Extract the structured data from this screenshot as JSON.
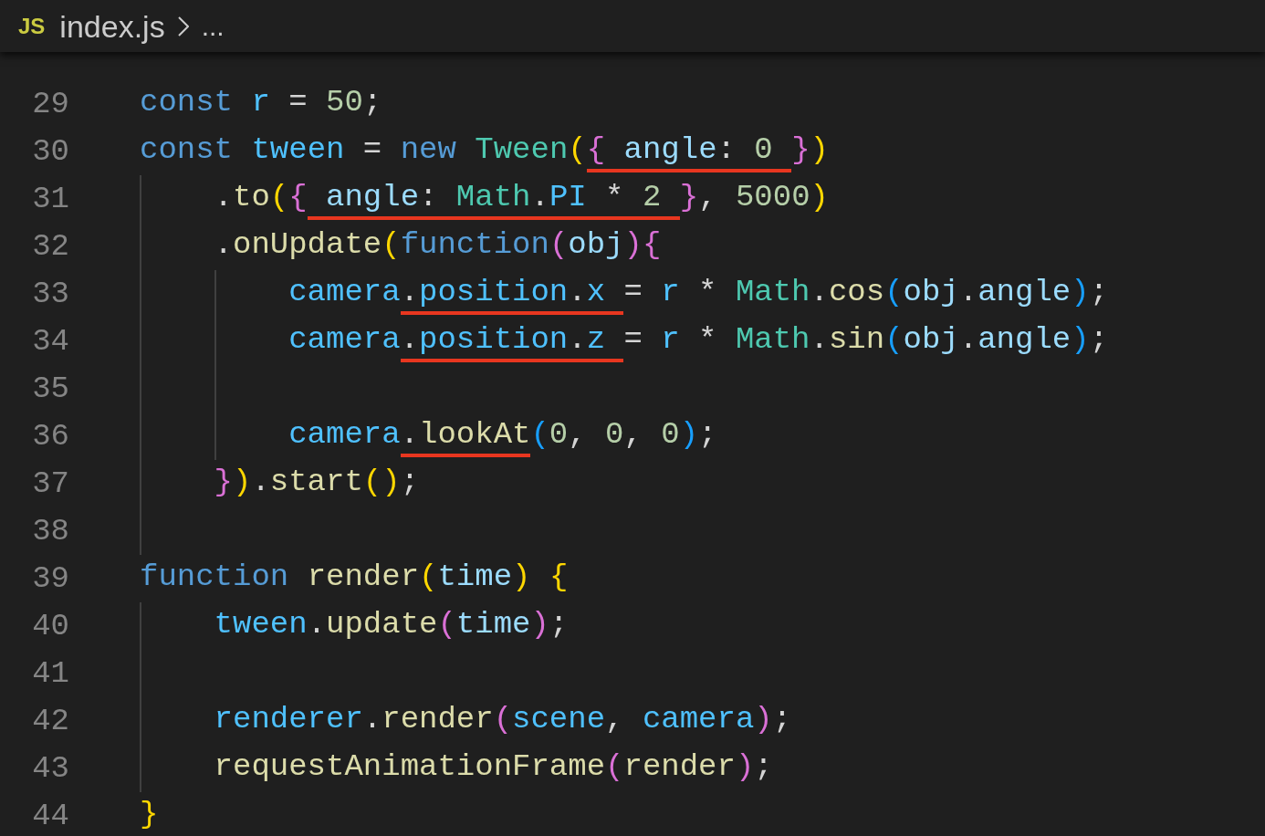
{
  "breadcrumb": {
    "file_icon": "JS",
    "file": "index.js",
    "more": "..."
  },
  "lines": [
    {
      "number": "29",
      "tokens": [
        {
          "text": "const",
          "kind": "kw"
        },
        {
          "text": " r",
          "kind": "cvar"
        },
        {
          "text": " = ",
          "kind": "p"
        },
        {
          "text": "50",
          "kind": "num"
        },
        {
          "text": ";",
          "kind": "p"
        }
      ]
    },
    {
      "number": "30",
      "tokens": [
        {
          "text": "const",
          "kind": "kw"
        },
        {
          "text": " tween",
          "kind": "cvar"
        },
        {
          "text": " = ",
          "kind": "p"
        },
        {
          "text": "new",
          "kind": "kw"
        },
        {
          "text": " Tween",
          "kind": "cls"
        },
        {
          "text": "(",
          "kind": "b1"
        },
        {
          "text": "{",
          "kind": "b2",
          "underlined": true
        },
        {
          "text": " angle",
          "kind": "var",
          "underlined": true
        },
        {
          "text": ": ",
          "kind": "p",
          "underlined": true
        },
        {
          "text": "0 ",
          "kind": "num",
          "underlined": true
        },
        {
          "text": "}",
          "kind": "b2"
        },
        {
          "text": ")",
          "kind": "b1"
        }
      ],
      "children": [
        {
          "number": "31",
          "tokens": [
            {
              "text": ".",
              "kind": "p"
            },
            {
              "text": "to",
              "kind": "fn"
            },
            {
              "text": "(",
              "kind": "b1"
            },
            {
              "text": "{",
              "kind": "b2"
            },
            {
              "text": " angle",
              "kind": "var",
              "underlined": true
            },
            {
              "text": ": ",
              "kind": "p",
              "underlined": true
            },
            {
              "text": "Math",
              "kind": "cls",
              "underlined": true
            },
            {
              "text": ".",
              "kind": "p",
              "underlined": true
            },
            {
              "text": "PI",
              "kind": "cvar",
              "underlined": true
            },
            {
              "text": " * ",
              "kind": "p",
              "underlined": true
            },
            {
              "text": "2 ",
              "kind": "num",
              "underlined": true
            },
            {
              "text": "}",
              "kind": "b2"
            },
            {
              "text": ", ",
              "kind": "p"
            },
            {
              "text": "5000",
              "kind": "num"
            },
            {
              "text": ")",
              "kind": "b1"
            }
          ]
        },
        {
          "number": "32",
          "tokens": [
            {
              "text": ".",
              "kind": "p"
            },
            {
              "text": "onUpdate",
              "kind": "fn"
            },
            {
              "text": "(",
              "kind": "b1"
            },
            {
              "text": "function",
              "kind": "kw"
            },
            {
              "text": "(",
              "kind": "b2"
            },
            {
              "text": "obj",
              "kind": "var"
            },
            {
              "text": ")",
              "kind": "b2"
            },
            {
              "text": "{",
              "kind": "b2"
            }
          ],
          "children": [
            {
              "number": "33",
              "tokens": [
                {
                  "text": "camera",
                  "kind": "cvar"
                },
                {
                  "text": ".",
                  "kind": "p",
                  "underlined": true
                },
                {
                  "text": "position",
                  "kind": "cvar",
                  "underlined": true
                },
                {
                  "text": ".",
                  "kind": "p",
                  "underlined": true
                },
                {
                  "text": "x ",
                  "kind": "cvar",
                  "underlined": true
                },
                {
                  "text": "= ",
                  "kind": "p"
                },
                {
                  "text": "r",
                  "kind": "cvar"
                },
                {
                  "text": " * ",
                  "kind": "p"
                },
                {
                  "text": "Math",
                  "kind": "cls"
                },
                {
                  "text": ".",
                  "kind": "p"
                },
                {
                  "text": "cos",
                  "kind": "fn"
                },
                {
                  "text": "(",
                  "kind": "b3"
                },
                {
                  "text": "obj",
                  "kind": "var"
                },
                {
                  "text": ".",
                  "kind": "p"
                },
                {
                  "text": "angle",
                  "kind": "var"
                },
                {
                  "text": ")",
                  "kind": "b3"
                },
                {
                  "text": ";",
                  "kind": "p"
                }
              ]
            },
            {
              "number": "34",
              "tokens": [
                {
                  "text": "camera",
                  "kind": "cvar"
                },
                {
                  "text": ".",
                  "kind": "p",
                  "underlined": true
                },
                {
                  "text": "position",
                  "kind": "cvar",
                  "underlined": true
                },
                {
                  "text": ".",
                  "kind": "p",
                  "underlined": true
                },
                {
                  "text": "z ",
                  "kind": "cvar",
                  "underlined": true
                },
                {
                  "text": "= ",
                  "kind": "p"
                },
                {
                  "text": "r",
                  "kind": "cvar"
                },
                {
                  "text": " * ",
                  "kind": "p"
                },
                {
                  "text": "Math",
                  "kind": "cls"
                },
                {
                  "text": ".",
                  "kind": "p"
                },
                {
                  "text": "sin",
                  "kind": "fn"
                },
                {
                  "text": "(",
                  "kind": "b3"
                },
                {
                  "text": "obj",
                  "kind": "var"
                },
                {
                  "text": ".",
                  "kind": "p"
                },
                {
                  "text": "angle",
                  "kind": "var"
                },
                {
                  "text": ")",
                  "kind": "b3"
                },
                {
                  "text": ";",
                  "kind": "p"
                }
              ]
            },
            {
              "number": "35"
            },
            {
              "number": "36",
              "tokens": [
                {
                  "text": "camera",
                  "kind": "cvar"
                },
                {
                  "text": ".",
                  "kind": "p",
                  "underlined": true
                },
                {
                  "text": "lookAt",
                  "kind": "fn",
                  "underlined": true
                },
                {
                  "text": "(",
                  "kind": "b3"
                },
                {
                  "text": "0",
                  "kind": "num"
                },
                {
                  "text": ", ",
                  "kind": "p"
                },
                {
                  "text": "0",
                  "kind": "num"
                },
                {
                  "text": ", ",
                  "kind": "p"
                },
                {
                  "text": "0",
                  "kind": "num"
                },
                {
                  "text": ")",
                  "kind": "b3"
                },
                {
                  "text": ";",
                  "kind": "p"
                }
              ]
            }
          ]
        },
        {
          "number": "37",
          "tokens": [
            {
              "text": "}",
              "kind": "b2"
            },
            {
              "text": ")",
              "kind": "b1"
            },
            {
              "text": ".",
              "kind": "p"
            },
            {
              "text": "start",
              "kind": "fn"
            },
            {
              "text": "(",
              "kind": "b1"
            },
            {
              "text": ")",
              "kind": "b1"
            },
            {
              "text": ";",
              "kind": "p"
            }
          ]
        },
        {
          "number": "38"
        }
      ]
    },
    {
      "number": "39",
      "tokens": [
        {
          "text": "function",
          "kind": "kw"
        },
        {
          "text": " render",
          "kind": "fn"
        },
        {
          "text": "(",
          "kind": "b1"
        },
        {
          "text": "time",
          "kind": "var"
        },
        {
          "text": ")",
          "kind": "b1"
        },
        {
          "text": " {",
          "kind": "b1"
        }
      ],
      "children": [
        {
          "number": "40",
          "tokens": [
            {
              "text": "tween",
              "kind": "cvar"
            },
            {
              "text": ".",
              "kind": "p"
            },
            {
              "text": "update",
              "kind": "fn"
            },
            {
              "text": "(",
              "kind": "b2"
            },
            {
              "text": "time",
              "kind": "var"
            },
            {
              "text": ")",
              "kind": "b2"
            },
            {
              "text": ";",
              "kind": "p"
            }
          ]
        },
        {
          "number": "41"
        },
        {
          "number": "42",
          "tokens": [
            {
              "text": "renderer",
              "kind": "cvar"
            },
            {
              "text": ".",
              "kind": "p"
            },
            {
              "text": "render",
              "kind": "fn"
            },
            {
              "text": "(",
              "kind": "b2"
            },
            {
              "text": "scene",
              "kind": "cvar"
            },
            {
              "text": ", ",
              "kind": "p"
            },
            {
              "text": "camera",
              "kind": "cvar"
            },
            {
              "text": ")",
              "kind": "b2"
            },
            {
              "text": ";",
              "kind": "p"
            }
          ]
        },
        {
          "number": "43",
          "tokens": [
            {
              "text": "requestAnimationFrame",
              "kind": "fn"
            },
            {
              "text": "(",
              "kind": "b2"
            },
            {
              "text": "render",
              "kind": "fn"
            },
            {
              "text": ")",
              "kind": "b2"
            },
            {
              "text": ";",
              "kind": "p"
            }
          ]
        }
      ]
    },
    {
      "number": "44",
      "tokens": [
        {
          "text": "}",
          "kind": "b1"
        }
      ]
    }
  ]
}
